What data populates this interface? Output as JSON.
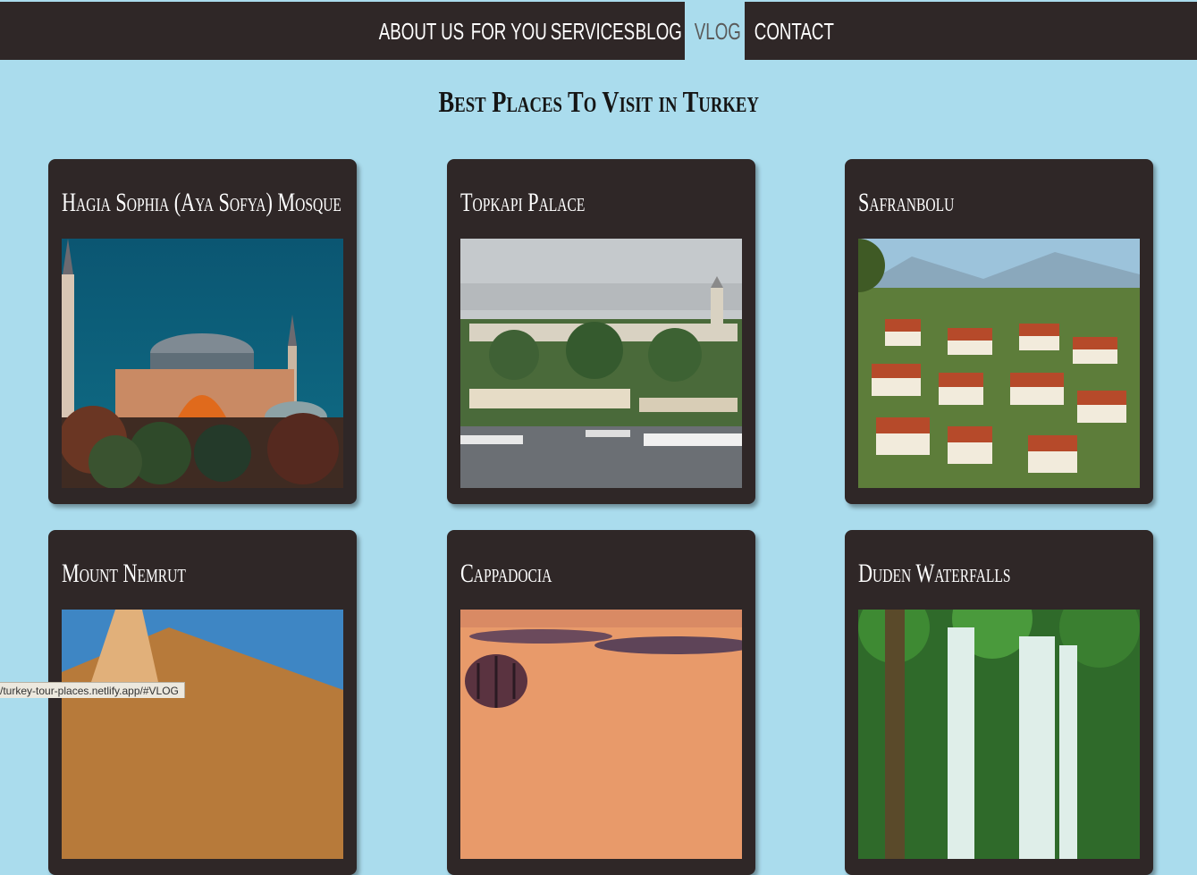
{
  "nav": {
    "items": [
      {
        "label": "ABOUT US"
      },
      {
        "label": "FOR YOU"
      },
      {
        "label": "SERVICES"
      },
      {
        "label": "BLOG"
      },
      {
        "label": "VLOG",
        "active": true
      },
      {
        "label": "CONTACT"
      }
    ]
  },
  "main": {
    "title": "Best Places To Visit in Turkey",
    "cards": [
      {
        "title": "Hagia Sophia (Aya Sofya) Mosque",
        "image": "hagia-sophia-photo"
      },
      {
        "title": "Topkapi Palace",
        "image": "topkapi-palace-photo"
      },
      {
        "title": "Safranbolu",
        "image": "safranbolu-photo"
      },
      {
        "title": "Mount Nemrut",
        "image": "mount-nemrut-photo"
      },
      {
        "title": "Cappadocia",
        "image": "cappadocia-photo"
      },
      {
        "title": "Duden Waterfalls",
        "image": "duden-waterfalls-photo"
      }
    ]
  },
  "status": {
    "url": "/turkey-tour-places.netlify.app/#VLOG"
  },
  "colors": {
    "nav_bg": "#2f2727",
    "page_bg": "#aadced",
    "card_bg": "#2f2727"
  }
}
